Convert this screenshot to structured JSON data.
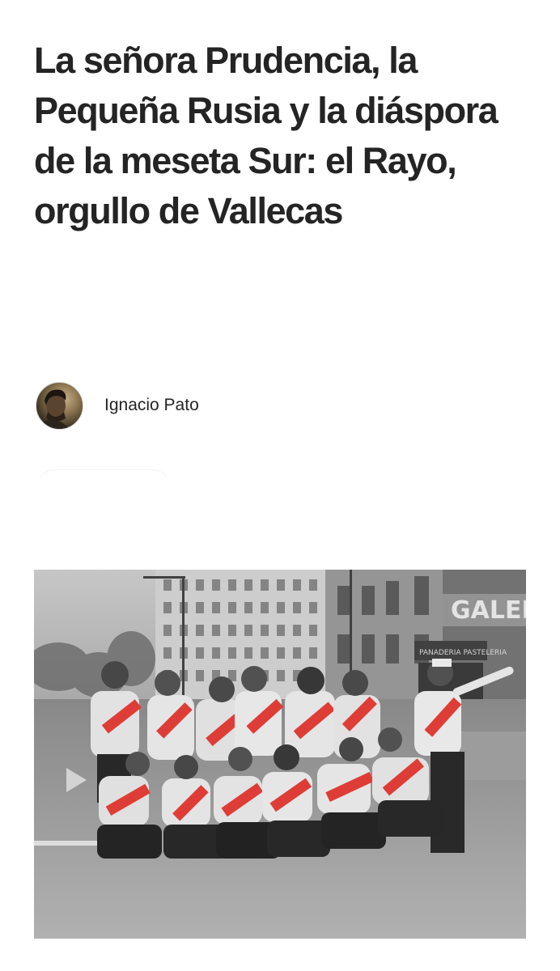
{
  "article": {
    "title": "La señora Prudencia, la Pequeña Rusia y la diáspora de la meseta Sur: el Rayo, orgullo de Vallecas",
    "author": {
      "name": "Ignacio Pato"
    },
    "hero_image": {
      "storefront_sign": "GALER",
      "shop_sign": "PANADERIA PASTELERIA",
      "sash_color": "#e8403a"
    }
  }
}
